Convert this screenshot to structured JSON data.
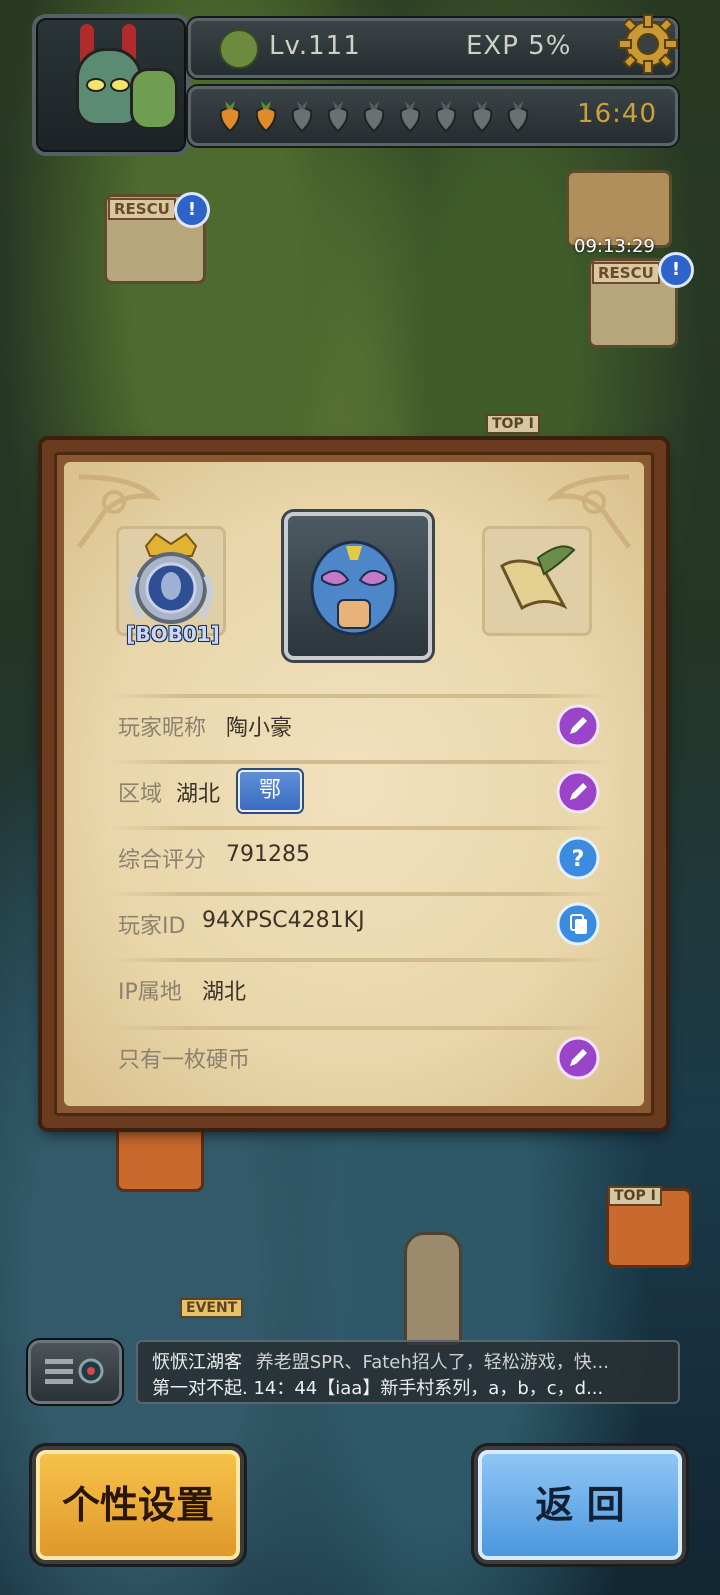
{
  "hud": {
    "level": "Lv.111",
    "exp": "EXP  5%",
    "timer": "16:40",
    "energy_full": 2,
    "energy_total": 9
  },
  "map": {
    "rescue_label": "RESCU",
    "timer": "09:13:29",
    "top_label": "TOP I",
    "event_label": "EVENT",
    "alert_glyph": "!"
  },
  "profile": {
    "badge_label": "[BOB01]",
    "rows": [
      {
        "key": "玩家昵称",
        "value": "陶小豪",
        "action": "edit-icon"
      },
      {
        "key": "区域",
        "value": "湖北",
        "tag": "鄂",
        "action": "edit-icon"
      },
      {
        "key": "综合评分",
        "value": "791285",
        "action": "help-icon"
      },
      {
        "key": "玩家ID",
        "value": "94XPSC4281KJ",
        "action": "copy-icon"
      },
      {
        "key": "IP属地",
        "value": "湖北"
      },
      {
        "key": "只有一枚硬币",
        "value": "",
        "action": "edit-icon"
      }
    ]
  },
  "chat": {
    "line1_name": "恹恹江湖客",
    "line1_text": "养老盟SPR、Fateh招人了，轻松游戏，快...",
    "line2_text": "第一对不起. 14：44【iaa】新手村系列，a，b，c，d..."
  },
  "buttons": {
    "settings": "个性设置",
    "back": "返 回"
  },
  "colors": {
    "panel": "#ecdcb4",
    "edit_purple": "#9a45c9",
    "info_blue": "#3b8ce0",
    "gold": "#f0b33d"
  }
}
